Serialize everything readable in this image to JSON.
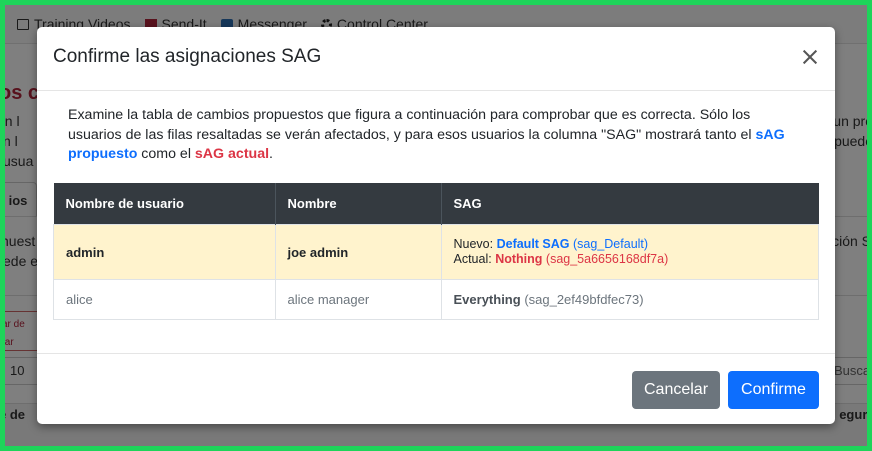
{
  "navbar": {
    "items": [
      {
        "label": "Training Videos",
        "icon": "film-icon"
      },
      {
        "label": "Send-It",
        "icon": "envelope-icon"
      },
      {
        "label": "Messenger",
        "icon": "messenger-icon"
      },
      {
        "label": "Control Center",
        "icon": "gear-icon"
      }
    ]
  },
  "background": {
    "title_fragment": "os c",
    "left_text": [
      "en l",
      "n l",
      "usua",
      "nuest",
      "ede e"
    ],
    "right_text": [
      "un pro",
      "puede",
      "ción S"
    ],
    "tab_label": "ios",
    "action_button_lines": [
      "ar de",
      "tar"
    ],
    "page_size": "10",
    "search_placeholder": "Buscar usua",
    "bottom_left": "e de",
    "bottom_right": "eguri"
  },
  "modal": {
    "title": "Confirme las asignaciones SAG",
    "description_part1": "Examine la tabla de cambios propuestos que figura a continuación para comprobar que es correcta. Sólo los usuarios de las filas resaltadas se verán afectados, y para esos usuarios la columna \"SAG\" mostrará tanto el ",
    "description_proposed": "sAG propuesto",
    "description_part2": " como el ",
    "description_current": "sAG actual",
    "description_end": ".",
    "table": {
      "headers": [
        "Nombre de usuario",
        "Nombre",
        "SAG"
      ],
      "rows": [
        {
          "username": "admin",
          "name": "joe admin",
          "new_label": "Nuevo:",
          "new_value": "Default SAG",
          "new_code": "(sag_Default)",
          "current_label": "Actual:",
          "current_value": "Nothing",
          "current_code": "(sag_5a6656168df7a)"
        },
        {
          "username": "alice",
          "name": "alice manager",
          "value": "Everything",
          "code": "(sag_2ef49bfdfec73)"
        }
      ]
    },
    "buttons": {
      "cancel": "Cancelar",
      "confirm": "Confirme"
    }
  },
  "colors": {
    "accent_blue": "#0d6efd",
    "danger_red": "#dc3545",
    "highlight_row": "#fff3cd",
    "table_header": "#343a40",
    "screenshot_border": "#1ed45a"
  }
}
